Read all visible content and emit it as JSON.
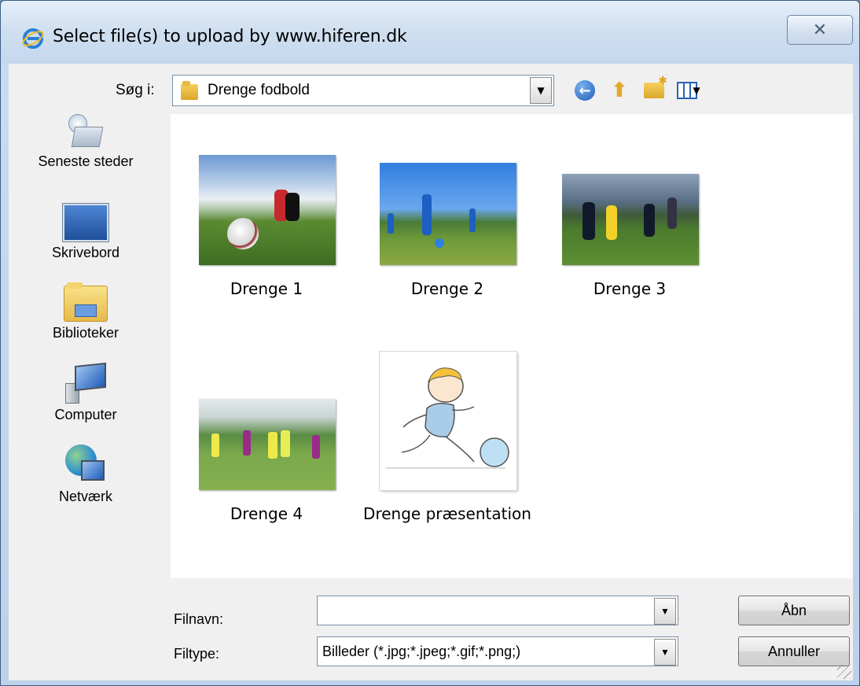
{
  "window": {
    "title": "Select file(s) to upload by www.hiferen.dk",
    "close_label": "✕"
  },
  "lookin": {
    "label": "Søg i:",
    "value": "Drenge fodbold"
  },
  "toolbar": {
    "icons": [
      "back-icon",
      "up-folder-icon",
      "new-folder-icon",
      "view-menu-icon"
    ]
  },
  "places": [
    {
      "label": "Seneste steder",
      "icon": "recent-places-icon"
    },
    {
      "label": "Skrivebord",
      "icon": "desktop-icon"
    },
    {
      "label": "Biblioteker",
      "icon": "libraries-icon"
    },
    {
      "label": "Computer",
      "icon": "computer-icon"
    },
    {
      "label": "Netværk",
      "icon": "network-icon"
    }
  ],
  "files": [
    {
      "name": "Drenge 1"
    },
    {
      "name": "Drenge 2"
    },
    {
      "name": "Drenge 3"
    },
    {
      "name": "Drenge 4"
    },
    {
      "name": "Drenge præsentation"
    }
  ],
  "filename": {
    "label": "Filnavn:",
    "value": ""
  },
  "filetype": {
    "label": "Filtype:",
    "value": "Billeder (*.jpg;*.jpeg;*.gif;*.png;)"
  },
  "buttons": {
    "open": "Åbn",
    "cancel": "Annuller"
  }
}
